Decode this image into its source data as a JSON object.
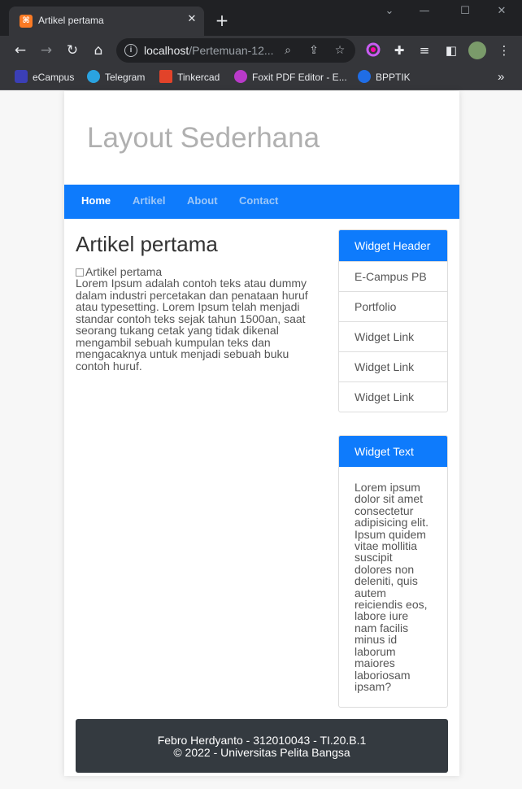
{
  "browser": {
    "tab_title": "Artikel pertama",
    "tab_favicon": "xampp-icon",
    "url_host": "localhost",
    "url_path": "/Pertemuan-12...",
    "bookmarks": [
      {
        "label": "eCampus",
        "icon": "ecampus-icon",
        "color": "#3b3fb6"
      },
      {
        "label": "Telegram",
        "icon": "telegram-icon",
        "color": "#2aa3e0"
      },
      {
        "label": "Tinkercad",
        "icon": "tinkercad-icon",
        "color": "#e2432a"
      },
      {
        "label": "Foxit PDF Editor - E...",
        "icon": "foxit-icon",
        "color": "#b93ac9"
      },
      {
        "label": "BPPTIK",
        "icon": "bpptik-icon",
        "color": "#1f6de6"
      }
    ],
    "more_label": "»"
  },
  "page": {
    "site_title": "Layout Sederhana",
    "nav": [
      {
        "label": "Home",
        "active": true
      },
      {
        "label": "Artikel",
        "active": false
      },
      {
        "label": "About",
        "active": false
      },
      {
        "label": "Contact",
        "active": false
      }
    ],
    "article": {
      "title": "Artikel pertama",
      "image_alt": "Artikel pertama",
      "body": "Lorem Ipsum adalah contoh teks atau dummy dalam industri percetakan dan penataan huruf atau typesetting. Lorem Ipsum telah menjadi standar contoh teks sejak tahun 1500an, saat seorang tukang cetak yang tidak dikenal mengambil sebuah kumpulan teks dan mengacaknya untuk menjadi sebuah buku contoh huruf."
    },
    "widget1": {
      "header": "Widget Header",
      "links": [
        "E-Campus PB",
        "Portfolio",
        "Widget Link",
        "Widget Link",
        "Widget Link"
      ]
    },
    "widget2": {
      "header": "Widget Text",
      "text": "Lorem ipsum dolor sit amet consectetur adipisicing elit. Ipsum quidem vitae mollitia suscipit dolores non deleniti, quis autem reiciendis eos, labore iure nam facilis minus id laborum maiores laboriosam ipsam?"
    },
    "footer": {
      "line1": "Febro Herdyanto - 312010043 - TI.20.B.1",
      "line2": "© 2022 - Universitas Pelita Bangsa"
    }
  },
  "colors": {
    "accent": "#0e7bfc",
    "footer_bg": "#343a40"
  }
}
